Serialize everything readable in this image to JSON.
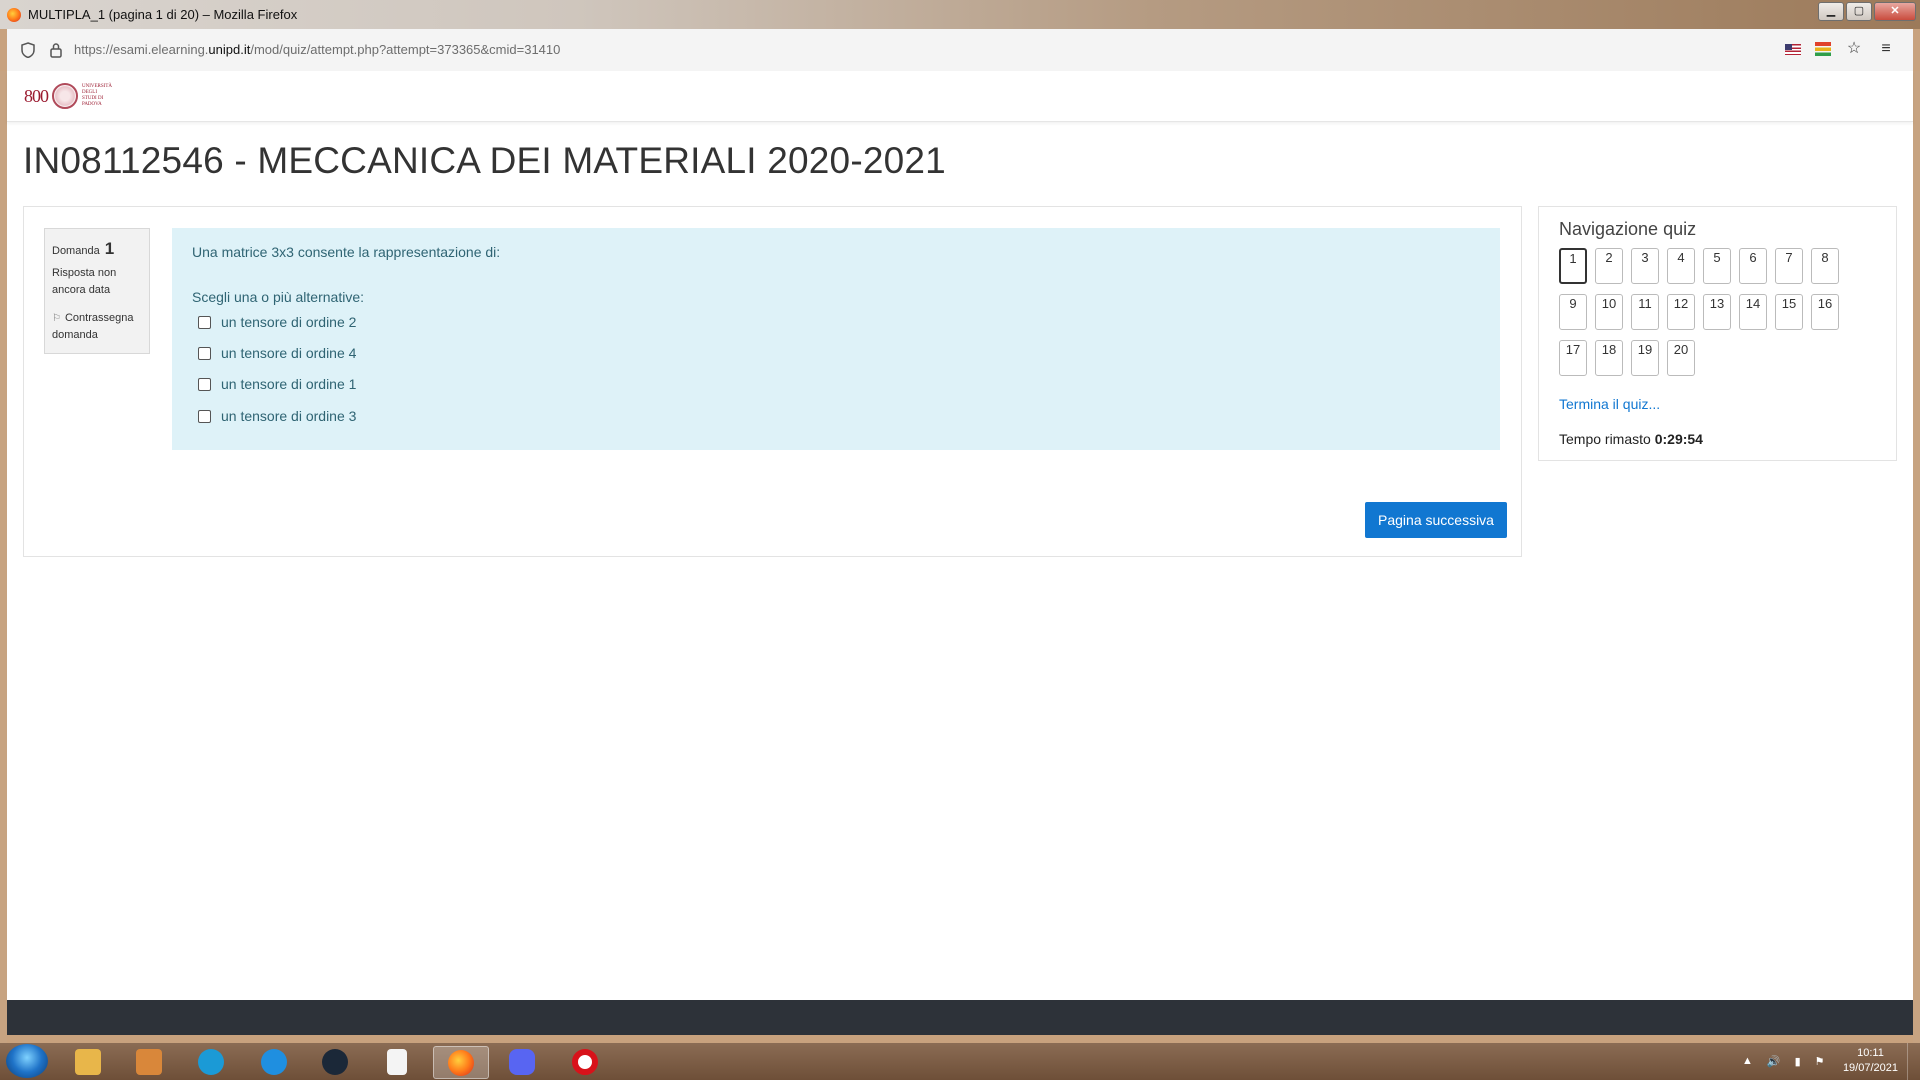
{
  "window": {
    "title": "MULTIPLA_1 (pagina 1 di 20) – Mozilla Firefox",
    "minimize": "▁",
    "maximize": "▢",
    "close": "✕"
  },
  "toolbar": {
    "url_prefix": "https://esami.elearning.",
    "url_domain": "unipd.it",
    "url_suffix": "/mod/quiz/attempt.php?attempt=373365&cmid=31410",
    "menu_glyph": "≡",
    "star_glyph": "☆"
  },
  "site": {
    "logo_800": "800",
    "logo_text": "UNIVERSITÀ DEGLI STUDI DI PADOVA"
  },
  "page_title": "IN08112546 - MECCANICA DEI MATERIALI 2020-2021",
  "question": {
    "label": "Domanda",
    "number": "1",
    "state": "Risposta non ancora data",
    "flag_label": "Contrassegna domanda",
    "text": "Una matrice 3x3 consente la rappresentazione di:",
    "prompt": "Scegli una o più alternative:",
    "options": [
      "un tensore di ordine 2",
      "un tensore di ordine 4",
      "un tensore di ordine 1",
      "un tensore di ordine 3"
    ]
  },
  "next_button": "Pagina successiva",
  "quiz_nav": {
    "title": "Navigazione quiz",
    "buttons": [
      "1",
      "2",
      "3",
      "4",
      "5",
      "6",
      "7",
      "8",
      "9",
      "10",
      "11",
      "12",
      "13",
      "14",
      "15",
      "16",
      "17",
      "18",
      "19",
      "20"
    ],
    "current": "1",
    "finish_link": "Termina il quiz...",
    "timer_label": "Tempo rimasto",
    "timer_value": "0:29:54"
  },
  "taskbar": {
    "time": "10:11",
    "date": "19/07/2021",
    "colors": {
      "explorer": "#e8b64a",
      "media": "#d9873a",
      "logitech": "#1b9ad6",
      "bnet": "#1f8fe0",
      "steam": "#1b2838",
      "file": "#f4f4f4",
      "firefox": "#ff7b1a",
      "discord": "#5865f2",
      "opera": "#d8121a"
    }
  }
}
